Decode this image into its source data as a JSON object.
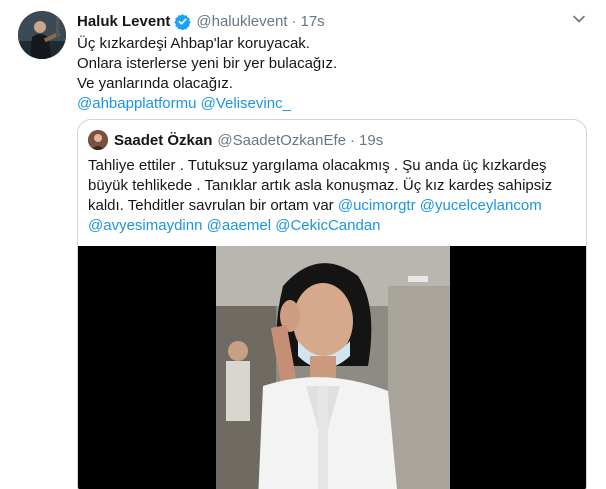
{
  "tweet": {
    "author_name": "Haluk Levent",
    "author_handle": "@haluklevent",
    "separator": "·",
    "time": "17s",
    "lines": [
      "Üç kızkardeşi Ahbap'lar koruyacak.",
      "Onlara isterlerse yeni bir yer bulacağız.",
      "Ve yanlarında olacağız."
    ],
    "mentions": [
      "@ahbapplatformu",
      "@Velisevinc_"
    ]
  },
  "quoted": {
    "author_name": "Saadet Özkan",
    "author_handle": "@SaadetOzkanEfe",
    "separator": "·",
    "time": "19s",
    "lines": [
      "Tahliye ettiler . Tutuksuz yargılama olacakmış . Şu anda üç kızkardeş",
      "büyük tehlikede . Tanıklar artık asla konuşmaz. Üç kız kardeş sahipsiz",
      "kaldı. Tehditler savrulan bir ortam var  "
    ],
    "line3_mentions": [
      "@ucimorgtr",
      "@yucelceylancom"
    ],
    "line4_mentions": [
      "@avyesimaydinn",
      "@aaemel",
      "@CekicCandan"
    ]
  },
  "colors": {
    "link": "#1b95e0",
    "verified": "#1da1f2",
    "secondary_text": "#657786",
    "border": "#ccd6dd"
  },
  "icons": {
    "verified": "verified-badge-icon",
    "caret": "chevron-down-icon"
  }
}
